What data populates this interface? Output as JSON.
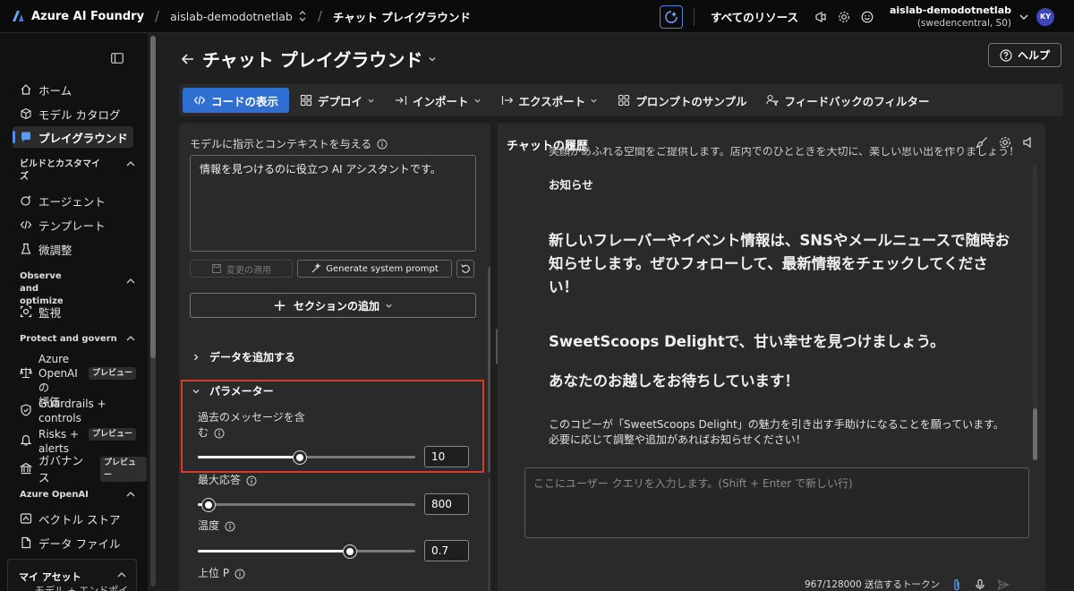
{
  "topbar": {
    "brand": "Azure AI Foundry",
    "project": "aislab-demodotnetlab",
    "page": "チャット プレイグラウンド",
    "all_resources": "すべてのリソース",
    "account_name": "aislab-demodotnetlab",
    "account_sub": "(swedencentral, S0)",
    "avatar_initials": "KY"
  },
  "sidebar": {
    "home": "ホーム",
    "catalog": "モデル カタログ",
    "playground": "プレイグラウンド",
    "section_build": "ビルドとカスタマイズ",
    "agents": "エージェント",
    "templates": "テンプレート",
    "finetune": "微調整",
    "section_observe": "Observe and optimize",
    "monitor": "監視",
    "section_protect": "Protect and govern",
    "eval_l1": "Azure",
    "eval_l2": "OpenAI の",
    "eval_l3": "評価",
    "guard_l1": "Guardrails +",
    "guard_l2": "controls",
    "risks_l1": "Risks +",
    "risks_l2": "alerts",
    "governance": "ガバナンス",
    "preview": "プレビュー",
    "section_openai": "Azure OpenAI",
    "vector_store": "ベクトル ストア",
    "data_files": "データ ファイル",
    "my_assets": "マイ アセット",
    "my_assets_sub": "モデル + エンドポイ"
  },
  "main": {
    "title": "チャット プレイグラウンド",
    "help": "ヘルプ"
  },
  "toolbar": {
    "view_code": "コードの表示",
    "deploy": "デプロイ",
    "import": "インポート",
    "export": "エクスポート",
    "prompt_samples": "プロンプトのサンプル",
    "feedback_filter": "フィードバックのフィルター"
  },
  "setup": {
    "system_label": "モデルに指示とコンテキストを与える",
    "system_message": "情報を見つけるのに役立つ AI アシスタントです。",
    "apply_changes": "変更の適用",
    "generate_prompt": "Generate system prompt",
    "add_section": "セクションの追加",
    "add_data": "データを追加する",
    "parameters": "パラメーター",
    "past_messages_l1": "過去のメッセージを含",
    "past_messages_l2": "む",
    "past_messages_value": "10",
    "past_messages_pct": 47,
    "max_response": "最大応答",
    "max_response_value": "800",
    "max_response_pct": 5,
    "temperature": "温度",
    "temperature_value": "0.7",
    "temperature_pct": 70,
    "top_p": "上位 P"
  },
  "chat": {
    "title": "チャットの履歴",
    "cut_line": "笑顔があふれる空間をご提供します。店内でのひとときを大切に、楽しい思い出を作りましょう！",
    "heading": "お知らせ",
    "para1": "新しいフレーバーやイベント情報は、SNSやメールニュースで随時お知らせします。ぜひフォローして、最新情報をチェックしてください！",
    "para2": "SweetScoops Delightで、甘い幸せを見つけましょう。",
    "para3": "あなたのお越しをお待ちしています！",
    "closing": "このコピーが「SweetScoops Delight」の魅力を引き出す手助けになることを願っています。必要に応じて調整や追加があればお知らせください！",
    "input_placeholder": "ここにユーザー クエリを入力します。(Shift + Enter で新しい行)",
    "token_count": "967/128000 送信するトークン"
  },
  "colors": {
    "accent": "#2f6fd1",
    "highlight_border": "#d63a2a",
    "background": "#1f1f1f",
    "panel": "#2a2a2a"
  }
}
